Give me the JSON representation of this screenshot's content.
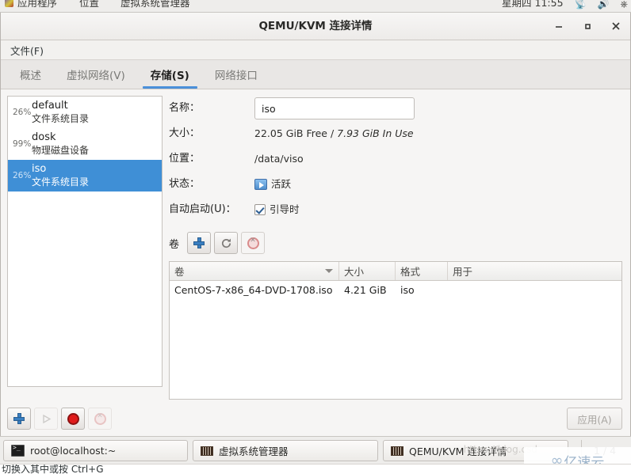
{
  "desktop_panel": {
    "menus": [
      "应用程序",
      "位置",
      "虚拟系统管理器"
    ],
    "clock": "星期四 11:55",
    "tray_icons": [
      "network-icon",
      "volume-icon",
      "power-icon"
    ]
  },
  "window": {
    "title": "QEMU/KVM 连接详情",
    "minimize_label": "minimize-icon",
    "maximize_label": "maximize-icon",
    "close_label": "close-icon"
  },
  "menubar": {
    "items": [
      {
        "label": "文件(F)"
      }
    ]
  },
  "tabs": [
    {
      "label": "概述",
      "active": false
    },
    {
      "label": "虚拟网络(V)",
      "active": false
    },
    {
      "label": "存储(S)",
      "active": true
    },
    {
      "label": "网络接口",
      "active": false
    }
  ],
  "pools": [
    {
      "usage": "26%",
      "name": "default",
      "type": "文件系统目录",
      "selected": false
    },
    {
      "usage": "99%",
      "name": "dosk",
      "type": "物理磁盘设备",
      "selected": false
    },
    {
      "usage": "26%",
      "name": "iso",
      "type": "文件系统目录",
      "selected": true
    }
  ],
  "details": {
    "name_label": "名称：",
    "name_value": "iso",
    "size_label": "大小：",
    "size_free": "22.05 GiB Free",
    "size_sep": " / ",
    "size_used": "7.93 GiB In Use",
    "location_label": "位置：",
    "location_value": "/data/viso",
    "state_label": "状态：",
    "state_value": "活跃",
    "autostart_label": "自动启动(U)：",
    "autostart_value": "引导时",
    "autostart_checked": true
  },
  "volumes_toolbar": {
    "label": "卷",
    "buttons": [
      {
        "name": "add-volume-button",
        "icon": "plus-icon",
        "enabled": true
      },
      {
        "name": "refresh-volumes-button",
        "icon": "refresh-icon",
        "enabled": true
      },
      {
        "name": "delete-volume-button",
        "icon": "delete-icon",
        "enabled": true
      }
    ]
  },
  "volumes_table": {
    "columns": [
      "卷",
      "大小",
      "格式",
      "用于"
    ],
    "sorted_column": "卷",
    "rows": [
      {
        "volume": "CentOS-7-x86_64-DVD-1708.iso",
        "size": "4.21 GiB",
        "format": "iso",
        "used_by": ""
      }
    ]
  },
  "pool_toolbar": {
    "buttons": [
      {
        "name": "add-pool-button",
        "icon": "plus-icon",
        "enabled": true
      },
      {
        "name": "start-pool-button",
        "icon": "play-icon",
        "enabled": false
      },
      {
        "name": "stop-pool-button",
        "icon": "stop-icon",
        "enabled": true
      },
      {
        "name": "delete-pool-button",
        "icon": "delete-icon",
        "enabled": false
      }
    ]
  },
  "apply_button": {
    "label": "应用(A)",
    "enabled": false
  },
  "taskbar": {
    "items": [
      {
        "label": "root@localhost:~",
        "icon": "terminal-icon",
        "active": false
      },
      {
        "label": "虚拟系统管理器",
        "icon": "vmm-icon",
        "active": false
      },
      {
        "label": "QEMU/KVM 连接详情",
        "icon": "vmm-icon",
        "active": true
      }
    ],
    "workspace": "1 / 4"
  },
  "watermark": {
    "mark": "∞",
    "text": "亿速云",
    "url": "https://blog.csd"
  },
  "bottom_strip": {
    "cut_text": "切换入其中或按 Ctrl+G"
  },
  "colors": {
    "accent": "#4a90d9",
    "selection": "#3f8fd6",
    "window_bg": "#f6f5f4",
    "panel_bg": "#eeedeb"
  }
}
